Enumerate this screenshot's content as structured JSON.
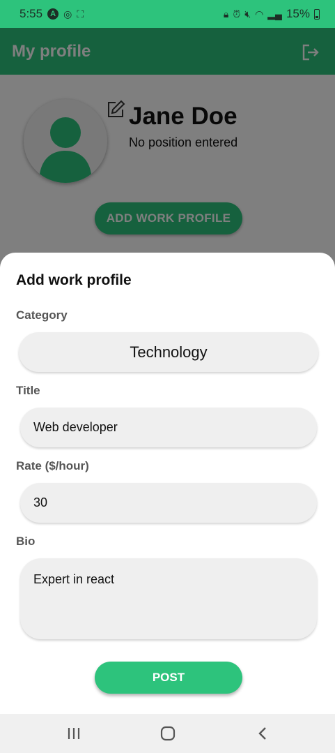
{
  "status_bar": {
    "time": "5:55",
    "left_icons": [
      "a-circle-icon",
      "alarm-app-icon",
      "screenshot-icon"
    ],
    "right_icons": [
      "lock-icon",
      "alarm-icon",
      "mute-icon",
      "wifi-icon",
      "signal-icon"
    ],
    "battery": "15%"
  },
  "app_bar": {
    "title": "My profile",
    "logout_icon": "logout-icon"
  },
  "profile": {
    "name": "Jane Doe",
    "position": "No position entered",
    "add_button": "ADD WORK PROFILE"
  },
  "sheet": {
    "title": "Add work profile",
    "category_label": "Category",
    "category_value": "Technology",
    "title_label": "Title",
    "title_value": "Web developer",
    "rate_label": "Rate ($/hour)",
    "rate_value": "30",
    "bio_label": "Bio",
    "bio_value": "Expert in react",
    "post_button": "POST"
  },
  "nav": {
    "items": [
      "recent-apps-icon",
      "home-icon",
      "back-icon"
    ]
  },
  "colors": {
    "accent": "#2dc37c",
    "field_bg": "#efefef"
  }
}
